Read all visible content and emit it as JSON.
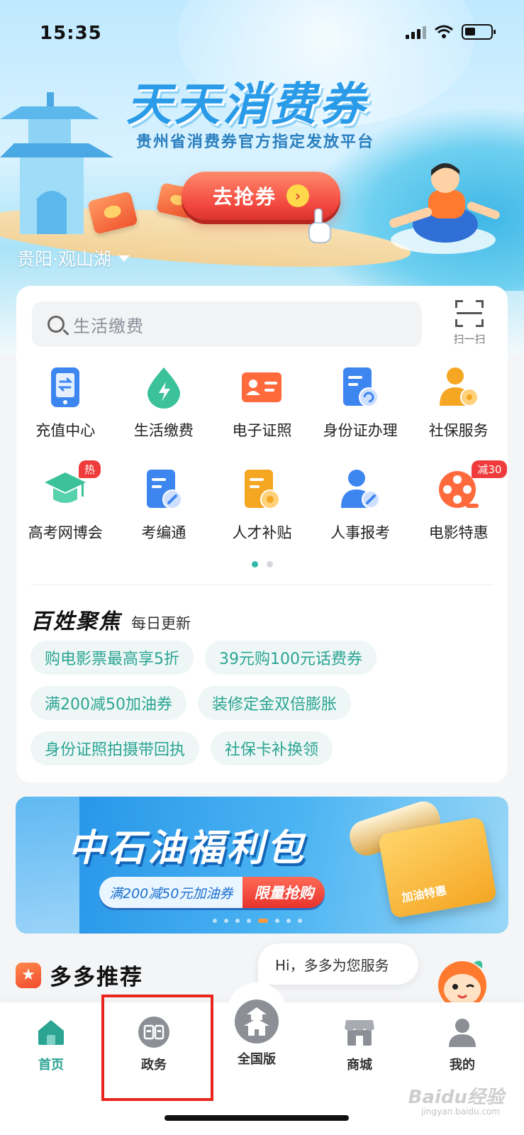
{
  "status_bar": {
    "time": "15:35"
  },
  "banner": {
    "title": "天天消费券",
    "subtitle": "贵州省消费券官方指定发放平台",
    "button_label": "去抢券",
    "button_arrow": "›",
    "location": "贵阳·观山湖"
  },
  "search": {
    "placeholder": "生活缴费",
    "scan_label": "扫一扫"
  },
  "services": [
    {
      "label": "充值中心",
      "icon": "phone-recharge-icon",
      "color": "#3d86f0"
    },
    {
      "label": "生活缴费",
      "icon": "water-drop-bolt-icon",
      "color": "#3cc29a"
    },
    {
      "label": "电子证照",
      "icon": "id-card-icon",
      "color": "#ff6a3d"
    },
    {
      "label": "身份证办理",
      "icon": "document-refresh-icon",
      "color": "#3d86f0"
    },
    {
      "label": "社保服务",
      "icon": "person-shield-icon",
      "color": "#f5a623"
    },
    {
      "label": "高考网博会",
      "icon": "graduation-cap-icon",
      "color": "#3cc29a",
      "badge": "热"
    },
    {
      "label": "考编通",
      "icon": "document-edit-icon",
      "color": "#3d86f0"
    },
    {
      "label": "人才补贴",
      "icon": "folder-coin-icon",
      "color": "#f5a623"
    },
    {
      "label": "人事报考",
      "icon": "person-edit-icon",
      "color": "#3d86f0"
    },
    {
      "label": "电影特惠",
      "icon": "film-reel-icon",
      "color": "#ff6a3d",
      "badge": "减30"
    }
  ],
  "focus": {
    "title": "百姓聚焦",
    "subtitle": "每日更新",
    "chips": [
      "购电影票最高享5折",
      "39元购100元话费券",
      "满200减50加油券",
      "装修定金双倍膨胀",
      "身份证照拍摄带回执",
      "社保卡补换领"
    ]
  },
  "promo": {
    "title": "中石油福利包",
    "tag_left": "满200减50元加油券",
    "tag_right": "限量抢购",
    "card_label": "加油特惠",
    "slide_count": 8,
    "active_slide": 4
  },
  "recommend": {
    "title": "多多推荐",
    "icon": "star-icon"
  },
  "assistant": {
    "greeting": "Hi，多多为您服务"
  },
  "tabs": [
    {
      "label": "首页",
      "icon": "home-icon",
      "active": true
    },
    {
      "label": "政务",
      "icon": "government-seal-icon",
      "active": false
    },
    {
      "label": "全国版",
      "icon": "pagoda-icon",
      "active": false
    },
    {
      "label": "商城",
      "icon": "store-icon",
      "active": false
    },
    {
      "label": "我的",
      "icon": "profile-icon",
      "active": false
    }
  ],
  "colors": {
    "accent": "#2ba493",
    "highlight": "#e8261d"
  },
  "watermark": {
    "text": "Baidu经验",
    "sub": "jingyan.baidu.com"
  }
}
